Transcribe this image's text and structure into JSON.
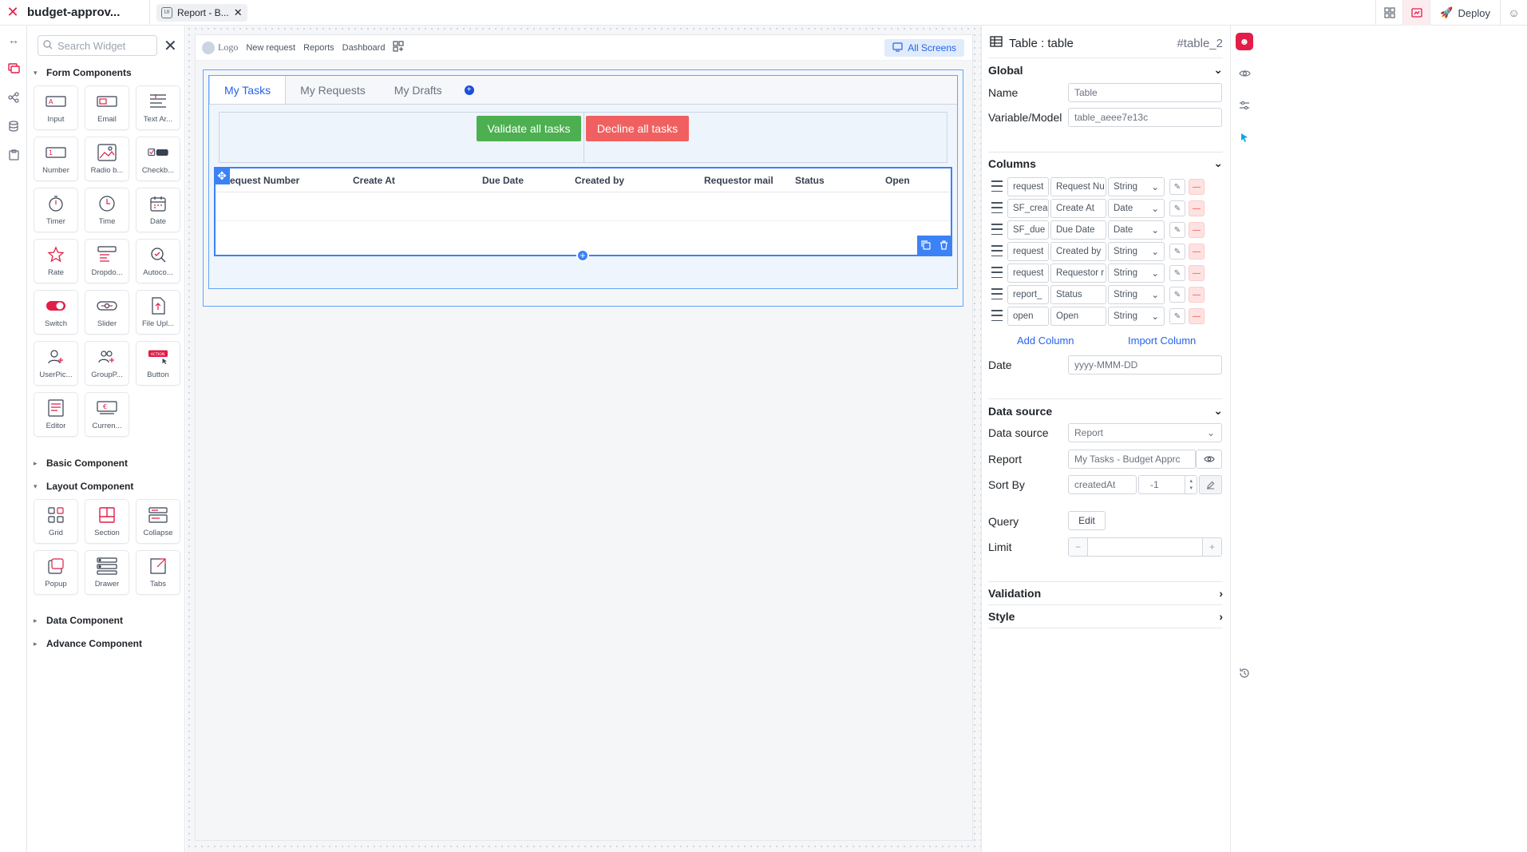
{
  "app": {
    "name": "budget-approv...",
    "doc_tab": "Report - B...",
    "doc_tab_icon": "UI",
    "deploy_label": "Deploy"
  },
  "widgets": {
    "search_placeholder": "Search Widget",
    "form_section": "Form Components",
    "form_items": [
      "Input",
      "Email",
      "Text Ar...",
      "Number",
      "Radio b...",
      "Checkb...",
      "Timer",
      "Time",
      "Date",
      "Rate",
      "Dropdo...",
      "Autoco...",
      "Switch",
      "Slider",
      "File Upl...",
      "UserPic...",
      "GroupP...",
      "Button",
      "Editor",
      "Curren..."
    ],
    "basic_section": "Basic Component",
    "layout_section": "Layout Component",
    "layout_items": [
      "Grid",
      "Section",
      "Collapse",
      "Popup",
      "Drawer",
      "Tabs"
    ],
    "data_section": "Data Component",
    "advance_section": "Advance Component"
  },
  "canvas": {
    "nav": {
      "logo": "Logo",
      "links": [
        "New request",
        "Reports",
        "Dashboard"
      ],
      "all_screens": "All Screens"
    },
    "tabs": [
      "My Tasks",
      "My Requests",
      "My Drafts"
    ],
    "validate_label": "Validate all tasks",
    "decline_label": "Decline all tasks",
    "table_headers": [
      "equest Number",
      "Create At",
      "Due Date",
      "Created by",
      "Requestor mail",
      "Status",
      "Open"
    ]
  },
  "props": {
    "title": "Table : table",
    "id": "#table_2",
    "global_section": "Global",
    "name_label": "Name",
    "name_value": "Table",
    "model_label": "Variable/Model",
    "model_value": "table_aeee7e13c",
    "columns_section": "Columns",
    "columns": [
      {
        "key": "request",
        "label": "Request Nu",
        "type": "String"
      },
      {
        "key": "SF_crea",
        "label": "Create At",
        "type": "Date"
      },
      {
        "key": "SF_due",
        "label": "Due Date",
        "type": "Date"
      },
      {
        "key": "request",
        "label": "Created by",
        "type": "String"
      },
      {
        "key": "request",
        "label": "Requestor r",
        "type": "String"
      },
      {
        "key": "report_",
        "label": "Status",
        "type": "String"
      },
      {
        "key": "open",
        "label": "Open",
        "type": "String"
      }
    ],
    "add_column": "Add Column",
    "import_column": "Import Column",
    "date_label": "Date",
    "date_placeholder": "yyyy-MMM-DD",
    "datasource_section": "Data source",
    "datasource_label": "Data source",
    "datasource_value": "Report",
    "report_label": "Report",
    "report_value": "My Tasks - Budget Apprc",
    "sortby_label": "Sort By",
    "sortby_field": "createdAt",
    "sortby_order": "-1",
    "query_label": "Query",
    "query_button": "Edit",
    "limit_label": "Limit",
    "validation_section": "Validation",
    "style_section": "Style"
  },
  "colors": {
    "accent": "#e11d48",
    "primary": "#3b82f6",
    "success": "#4caf50",
    "danger": "#f06060"
  }
}
